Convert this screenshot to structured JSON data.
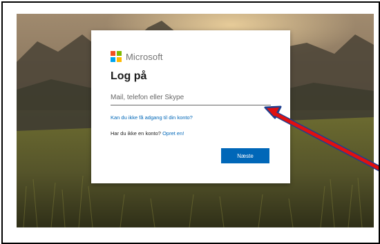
{
  "brand": {
    "name": "Microsoft",
    "colors": [
      "#f25022",
      "#7fba00",
      "#00a4ef",
      "#ffb900"
    ]
  },
  "signin": {
    "title": "Log på",
    "input_placeholder": "Mail, telefon eller Skype",
    "input_value": "",
    "forgot_link": "Kan du ikke få adgang til din konto?",
    "no_account_text": "Har du ikke en konto?",
    "create_link": "Opret en!",
    "next_button": "Næste"
  },
  "annotation": {
    "arrow_color": "#e01010",
    "arrow_outline": "#1f3f8f"
  },
  "colors": {
    "accent": "#0067b8",
    "text": "#1b1b1b",
    "muted": "#666666"
  }
}
